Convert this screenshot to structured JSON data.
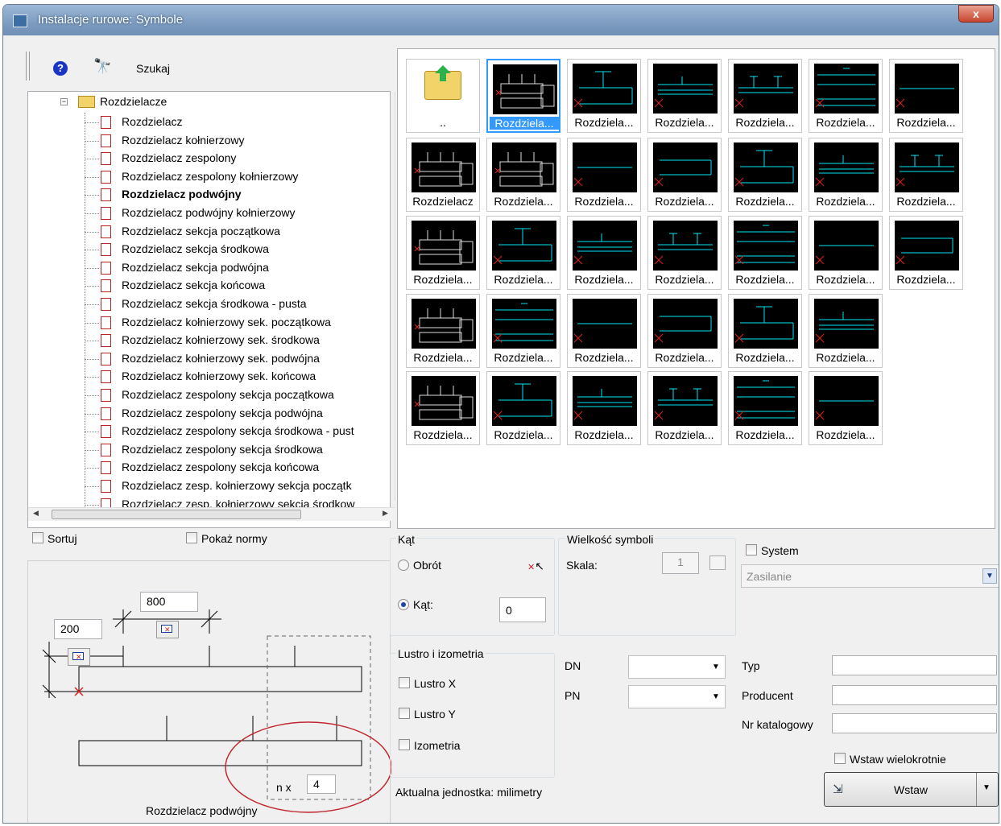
{
  "window": {
    "title": "Instalacje rurowe: Symbole",
    "close": "x"
  },
  "toolbar": {
    "search_label": "Szukaj"
  },
  "tree": {
    "root": "Rozdzielacze",
    "items": [
      {
        "label": "Rozdzielacz",
        "bold": false
      },
      {
        "label": "Rozdzielacz kołnierzowy",
        "bold": false
      },
      {
        "label": "Rozdzielacz zespolony",
        "bold": false
      },
      {
        "label": "Rozdzielacz zespolony kołnierzowy",
        "bold": false
      },
      {
        "label": "Rozdzielacz podwójny",
        "bold": true
      },
      {
        "label": "Rozdzielacz podwójny kołnierzowy",
        "bold": false
      },
      {
        "label": "Rozdzielacz sekcja początkowa",
        "bold": false
      },
      {
        "label": "Rozdzielacz sekcja środkowa",
        "bold": false
      },
      {
        "label": "Rozdzielacz sekcja podwójna",
        "bold": false
      },
      {
        "label": "Rozdzielacz sekcja końcowa",
        "bold": false
      },
      {
        "label": "Rozdzielacz sekcja środkowa - pusta",
        "bold": false
      },
      {
        "label": "Rozdzielacz kołnierzowy sek. początkowa",
        "bold": false
      },
      {
        "label": "Rozdzielacz kołnierzowy sek. środkowa",
        "bold": false
      },
      {
        "label": "Rozdzielacz kołnierzowy sek. podwójna",
        "bold": false
      },
      {
        "label": "Rozdzielacz kołnierzowy sek. końcowa",
        "bold": false
      },
      {
        "label": "Rozdzielacz zespolony sekcja początkowa",
        "bold": false
      },
      {
        "label": "Rozdzielacz zespolony sekcja podwójna",
        "bold": false
      },
      {
        "label": "Rozdzielacz zespolony sekcja środkowa - pust",
        "bold": false
      },
      {
        "label": "Rozdzielacz zespolony sekcja środkowa",
        "bold": false
      },
      {
        "label": "Rozdzielacz zespolony sekcja końcowa",
        "bold": false
      },
      {
        "label": "Rozdzielacz zesp. kołnierzowy sekcja początk",
        "bold": false
      },
      {
        "label": "Rozdzielacz zesp. kołnierzowy sekcja środkow",
        "bold": false
      }
    ]
  },
  "gallery": {
    "up_label": "..",
    "tiles": [
      [
        "Rozdziela...",
        "Rozdziela...",
        "Rozdziela...",
        "Rozdziela...",
        "Rozdziela...",
        "Rozdziela..."
      ],
      [
        "Rozdzielacz",
        "Rozdziela...",
        "Rozdziela...",
        "Rozdziela...",
        "Rozdziela...",
        "Rozdziela...",
        "Rozdziela..."
      ],
      [
        "Rozdziela...",
        "Rozdziela...",
        "Rozdziela...",
        "Rozdziela...",
        "Rozdziela...",
        "Rozdziela...",
        "Rozdziela..."
      ],
      [
        "Rozdziela...",
        "Rozdziela...",
        "Rozdziela...",
        "Rozdziela...",
        "Rozdziela...",
        "Rozdziela..."
      ],
      [
        "Rozdziela...",
        "Rozdziela...",
        "Rozdziela...",
        "Rozdziela...",
        "Rozdziela...",
        "Rozdziela..."
      ]
    ]
  },
  "options": {
    "sort": "Sortuj",
    "show_norms": "Pokaż normy"
  },
  "preview": {
    "dim1": "800",
    "dim2": "200",
    "count_label": "n x",
    "count": "4",
    "caption": "Rozdzielacz podwójny"
  },
  "angle": {
    "title": "Kąt",
    "rotation": "Obrót",
    "angle": "Kąt:",
    "angle_value": "0"
  },
  "size": {
    "title": "Wielkość symboli",
    "scale_label": "Skala:",
    "scale_value": "1"
  },
  "system": {
    "label": "System",
    "selected": "Zasilanie"
  },
  "mirror": {
    "title": "Lustro i izometria",
    "mirror_x": "Lustro X",
    "mirror_y": "Lustro Y",
    "isometry": "Izometria"
  },
  "unit_text": "Aktualna jednostka: milimetry",
  "params": {
    "dn": "DN",
    "pn": "PN",
    "type": "Typ",
    "producer": "Producent",
    "catalog": "Nr katalogowy"
  },
  "insert": {
    "multi": "Wstaw wielokrotnie",
    "button": "Wstaw"
  },
  "colors": {
    "cyan": "#00e5f5",
    "red": "#e02020",
    "select": "#3399ff"
  }
}
